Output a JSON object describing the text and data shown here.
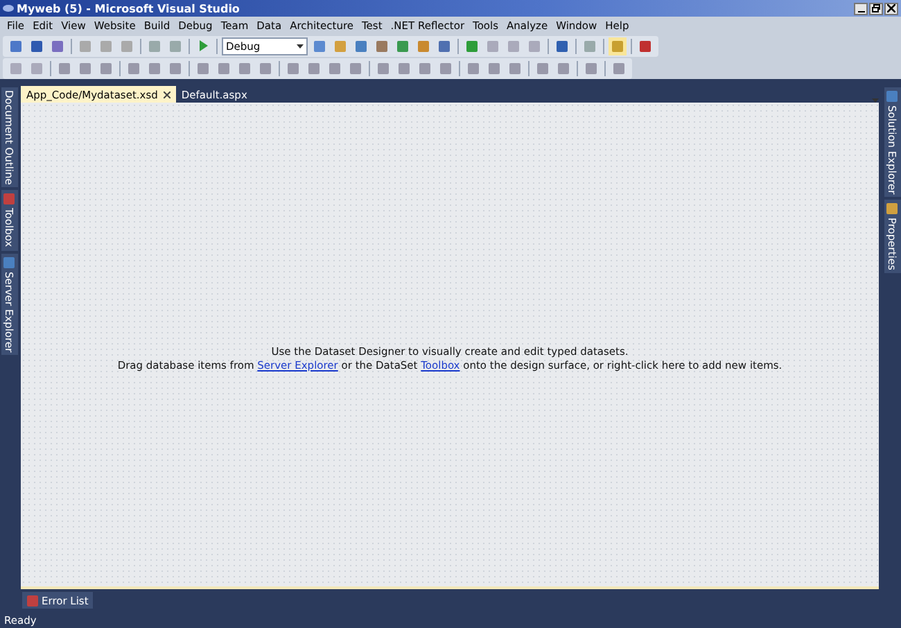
{
  "window": {
    "title": "Myweb (5) - Microsoft Visual Studio"
  },
  "menu": [
    "File",
    "Edit",
    "View",
    "Website",
    "Build",
    "Debug",
    "Team",
    "Data",
    "Architecture",
    "Test",
    ".NET Reflector",
    "Tools",
    "Analyze",
    "Window",
    "Help"
  ],
  "toolbar": {
    "configuration": "Debug"
  },
  "tabs": [
    {
      "label": "App_Code/Mydataset.xsd",
      "selected": true
    },
    {
      "label": "Default.aspx",
      "selected": false
    }
  ],
  "left_sidebar": [
    {
      "label": "Document Outline"
    },
    {
      "label": "Toolbox"
    },
    {
      "label": "Server Explorer"
    }
  ],
  "right_sidebar": [
    {
      "label": "Solution Explorer"
    },
    {
      "label": "Properties"
    }
  ],
  "designer": {
    "line_1": "Use the Dataset Designer to visually create and edit typed datasets.",
    "line_2": [
      {
        "text": "Drag database items from ",
        "link": false
      },
      {
        "text": "Server Explorer",
        "link": true
      },
      {
        "text": " or the DataSet ",
        "link": false
      },
      {
        "text": "Toolbox",
        "link": true
      },
      {
        "text": " onto the design surface, or right-click here to add new items.",
        "link": false
      }
    ]
  },
  "bottom_tabs": [
    {
      "label": "Error List"
    }
  ],
  "status_bar": {
    "text": "Ready"
  }
}
